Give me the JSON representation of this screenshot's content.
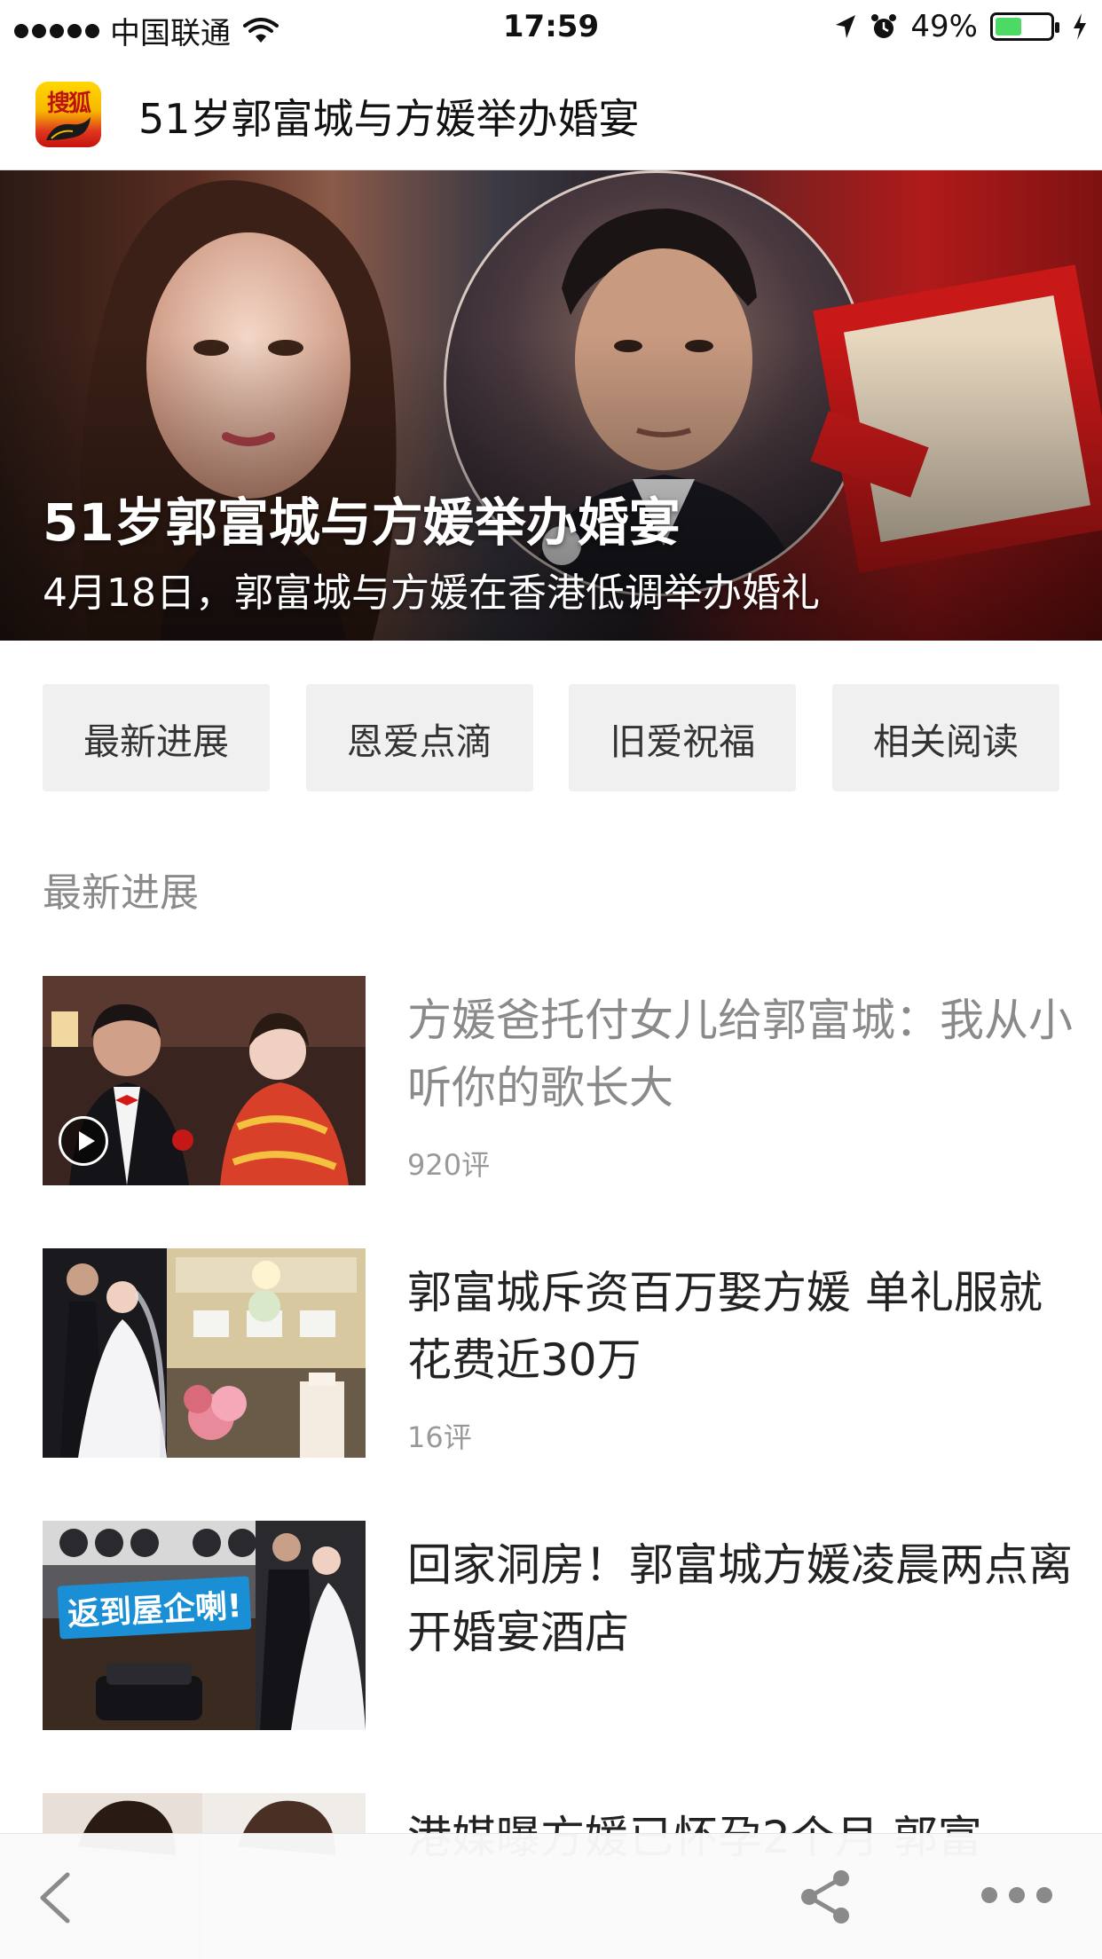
{
  "status_bar": {
    "carrier": "中国联通",
    "time": "17:59",
    "battery": "49%",
    "battery_level": 0.49,
    "battery_color": "#4cd964"
  },
  "header": {
    "logo_text": "搜狐",
    "title": "51岁郭富城与方媛举办婚宴"
  },
  "hero": {
    "title": "51岁郭富城与方媛举办婚宴",
    "subtitle": "4月18日，郭富城与方媛在香港低调举办婚礼"
  },
  "tabs": [
    {
      "label": "最新进展"
    },
    {
      "label": "恩爱点滴"
    },
    {
      "label": "旧爱祝福"
    },
    {
      "label": "相关阅读"
    }
  ],
  "section": {
    "heading": "最新进展"
  },
  "articles": [
    {
      "title": "方媛爸托付女儿给郭富城：我从小听你的歌长大",
      "comments": "920评",
      "has_video": true,
      "read": true
    },
    {
      "title": "郭富城斥资百万娶方媛 单礼服就花费近30万",
      "comments": "16评",
      "has_video": false,
      "read": false
    },
    {
      "title": "回家洞房！郭富城方媛凌晨两点离开婚宴酒店",
      "comments": "",
      "thumb_caption": "返到屋企喇!",
      "has_video": false,
      "read": false
    },
    {
      "title": "港媒曝方媛已怀孕2个月 郭富",
      "comments": "",
      "has_video": false,
      "read": false
    }
  ],
  "toolbar": {
    "icons": [
      "back-icon",
      "share-icon",
      "more-icon"
    ]
  }
}
